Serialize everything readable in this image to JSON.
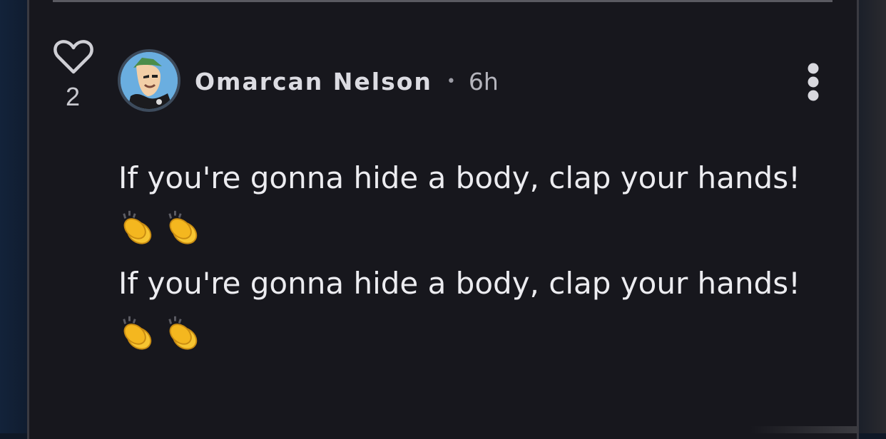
{
  "comment": {
    "like_count": "2",
    "author": {
      "name": "Omarcan Nelson",
      "separator": "•",
      "time_ago": "6h"
    },
    "body_lines": [
      "If you're gonna hide a body, clap your hands!",
      "If you're gonna hide a body, clap your hands!"
    ],
    "emoji": [
      "clapping-hands",
      "clapping-hands"
    ]
  },
  "icons": {
    "like": "heart-outline-icon",
    "menu": "vertical-ellipsis-icon",
    "avatar": "user-avatar"
  },
  "colors": {
    "card_background": "#17171d",
    "text_primary": "#ececf0",
    "text_secondary": "#b4b4bc",
    "clap_yellow": "#f7c531"
  }
}
